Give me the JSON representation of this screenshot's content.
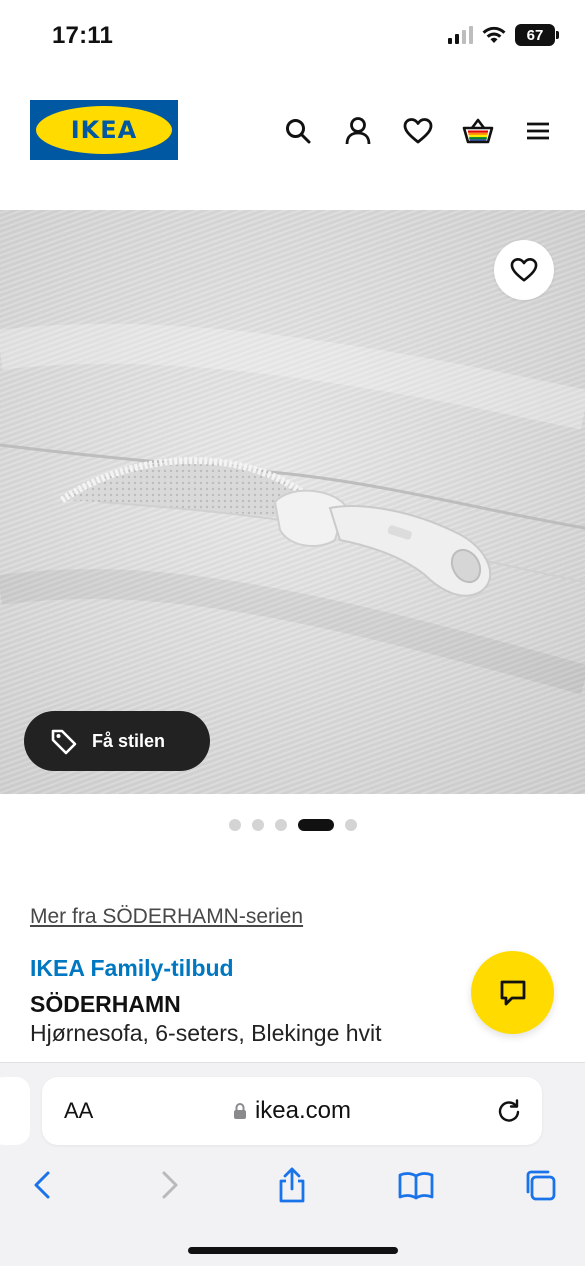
{
  "status_bar": {
    "time": "17:11",
    "battery": "67"
  },
  "header": {
    "logo_text": "IKEA",
    "icons": [
      "search-icon",
      "account-icon",
      "heart-icon",
      "basket-icon",
      "menu-icon"
    ]
  },
  "hero": {
    "style_button_label": "Få stilen",
    "image_index": 4,
    "image_count": 5
  },
  "product": {
    "series_link": "Mer fra SÖDERHAMN-serien",
    "offer_label": "IKEA Family-tilbud",
    "name": "SÖDERHAMN",
    "description": "Hjørnesofa, 6-seters, Blekinge hvit"
  },
  "browser": {
    "text_size_label": "AA",
    "url": "ikea.com"
  },
  "colors": {
    "ikea_blue": "#0058a3",
    "ikea_yellow": "#ffdb00",
    "offer_blue": "#0077c1"
  }
}
